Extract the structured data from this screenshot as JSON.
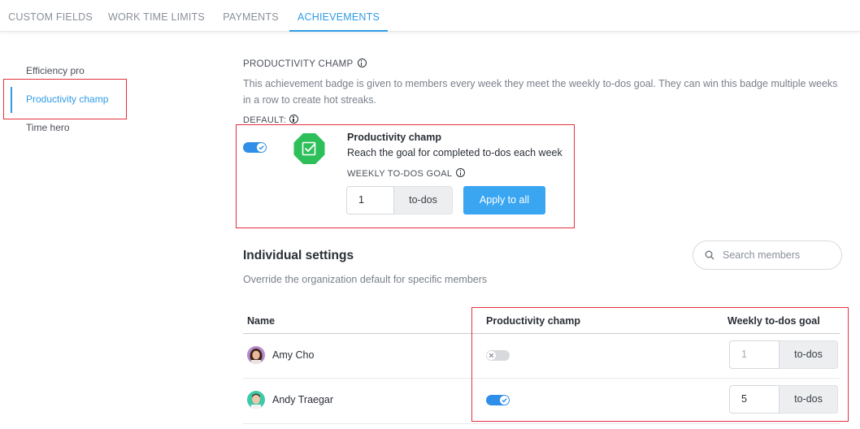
{
  "tabs": [
    {
      "label": "CUSTOM FIELDS"
    },
    {
      "label": "WORK TIME LIMITS"
    },
    {
      "label": "PAYMENTS"
    },
    {
      "label": "ACHIEVEMENTS",
      "active": true
    }
  ],
  "sidebar": {
    "items": [
      {
        "label": "Efficiency pro"
      },
      {
        "label": "Productivity champ",
        "active": true
      },
      {
        "label": "Time hero"
      }
    ]
  },
  "achievement": {
    "section_title": "PRODUCTIVITY CHAMP",
    "description": "This achievement badge is given to members every week they meet the weekly to-dos goal. They can win this badge multiple weeks in a row to create hot streaks.",
    "default_label": "DEFAULT:",
    "default_enabled": true,
    "card_title": "Productivity champ",
    "card_subtitle": "Reach the goal for completed to-dos each week",
    "goal_label": "WEEKLY TO-DOS GOAL",
    "goal_value": "1",
    "goal_unit": "to-dos",
    "apply_label": "Apply to all",
    "badge_icon": "checkbox-icon",
    "badge_color": "#2dbf5a"
  },
  "individual": {
    "title": "Individual settings",
    "subtitle": "Override the organization default for specific members",
    "search_placeholder": "Search members",
    "columns": {
      "name": "Name",
      "champ": "Productivity champ",
      "goal": "Weekly to-dos goal"
    },
    "members": [
      {
        "name": "Amy Cho",
        "enabled": false,
        "goal": "1",
        "unit": "to-dos"
      },
      {
        "name": "Andy Traegar",
        "enabled": true,
        "goal": "5",
        "unit": "to-dos"
      }
    ]
  },
  "colors": {
    "accent": "#2f9ce6",
    "button": "#3aa6f2",
    "highlight": "#e3303e"
  }
}
